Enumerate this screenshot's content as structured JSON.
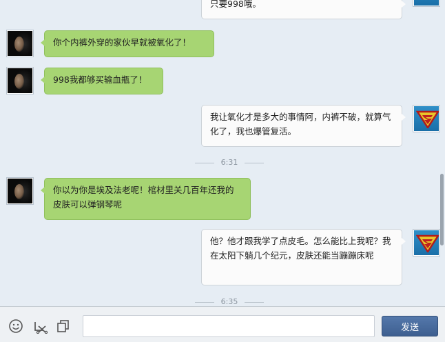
{
  "messages": [
    {
      "side": "right",
      "text": "只要998哦。"
    },
    {
      "side": "left",
      "text": "你个内裤外穿的家伙早就被氧化了！"
    },
    {
      "side": "left",
      "text": "998我都够买输血瓶了！"
    },
    {
      "side": "right",
      "text": "我让氧化才是多大的事情阿，内裤不破，就算气化了，我也爆管复活。"
    },
    {
      "side": "left",
      "text": "你以为你是埃及法老呢！棺材里关几百年还我的皮肤可以弹钢琴呢"
    },
    {
      "side": "right",
      "text": "他？他才跟我学了点皮毛。怎么能比上我呢？我在太阳下躺几个纪元，皮肤还能当蹦蹦床呢"
    }
  ],
  "timestamps": [
    "6:31",
    "6:35"
  ],
  "toolbar": {
    "icons": [
      "emoji-icon",
      "screenshot-icon",
      "copy-icon"
    ],
    "input_value": "",
    "send_label": "发送"
  },
  "colors": {
    "left_bubble": "#a7d573",
    "right_bubble": "#fbfbfb",
    "send_button": "#4a6c9e",
    "background": "#e6edf4"
  }
}
